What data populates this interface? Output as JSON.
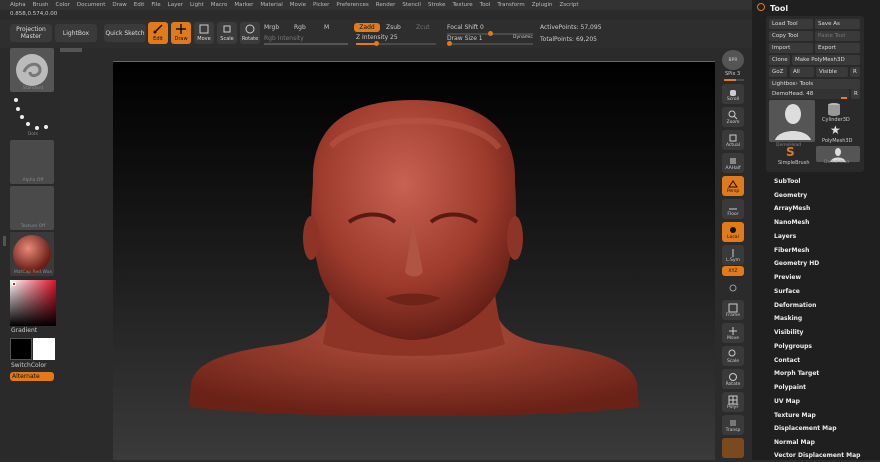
{
  "menu": [
    "Alpha",
    "Brush",
    "Color",
    "Document",
    "Draw",
    "Edit",
    "File",
    "Layer",
    "Light",
    "Macro",
    "Marker",
    "Material",
    "Movie",
    "Picker",
    "Preferences",
    "Render",
    "Stencil",
    "Stroke",
    "Texture",
    "Tool",
    "Transform",
    "Zplugin",
    "Zscript"
  ],
  "coords": "0.858,0.574,0.00",
  "toolbar": {
    "projection_master": "Projection Master",
    "lightbox": "LightBox",
    "quick_sketch": "Quick Sketch",
    "edit": "Edit",
    "draw": "Draw",
    "move": "Move",
    "scale": "Scale",
    "rotate": "Rotate",
    "mrgb": "Mrgb",
    "rgb": "Rgb",
    "m": "M",
    "rgb_intensity": "Rgb Intensity",
    "zadd": "Zadd",
    "zsub": "Zsub",
    "zcut": "Zcut",
    "z_intensity": "Z Intensity 25",
    "focal_shift": "Focal Shift 0",
    "draw_size": "Draw Size 1",
    "dynamic": "Dynamic",
    "active_points": "ActivePoints: 57,095",
    "total_points": "TotalPoints: 69,205"
  },
  "left": {
    "standard": "Standard",
    "dots": "Dots",
    "alpha_off": "Alpha Off",
    "texture_off": "Texture Off",
    "matcap": "MatCap Red Wax",
    "gradient": "Gradient",
    "switch_color": "SwitchColor",
    "alternate": "Alternate"
  },
  "rightbar": [
    "BPR",
    "SPix 3",
    "Scroll",
    "Zoom",
    "Actual",
    "AAHalf",
    "Persp",
    "Floor",
    "Local",
    "L.Sym",
    "XYZ",
    "Frame",
    "Move",
    "Scale",
    "Rotate",
    "PolyF",
    "Transp"
  ],
  "panel": {
    "title": "Tool",
    "load_tool": "Load Tool",
    "save_as": "Save As",
    "copy_tool": "Copy Tool",
    "paste_tool": "Paste Tool",
    "import": "Import",
    "export": "Export",
    "clone": "Clone",
    "make_polymesh": "Make PolyMesh3D",
    "goz": "GoZ",
    "all": "All",
    "visible": "Visible",
    "r": "R",
    "lightbox_tools": "Lightbox› Tools",
    "demohead": "DemoHead. 48",
    "tool_demohead": "DemoHead",
    "tool_cylinder": "Cylinder3D",
    "tool_polymesh": "PolyMesh3D",
    "tool_simplebrush": "SimpleBrush",
    "tool_demohead2": "DemoHead",
    "sections": [
      "SubTool",
      "Geometry",
      "ArrayMesh",
      "NanoMesh",
      "Layers",
      "FiberMesh",
      "Geometry HD",
      "Preview",
      "Surface",
      "Deformation",
      "Masking",
      "Visibility",
      "Polygroups",
      "Contact",
      "Morph Target",
      "Polypaint",
      "UV Map",
      "Texture Map",
      "Displacement Map",
      "Normal Map",
      "Vector Displacement Map"
    ]
  }
}
